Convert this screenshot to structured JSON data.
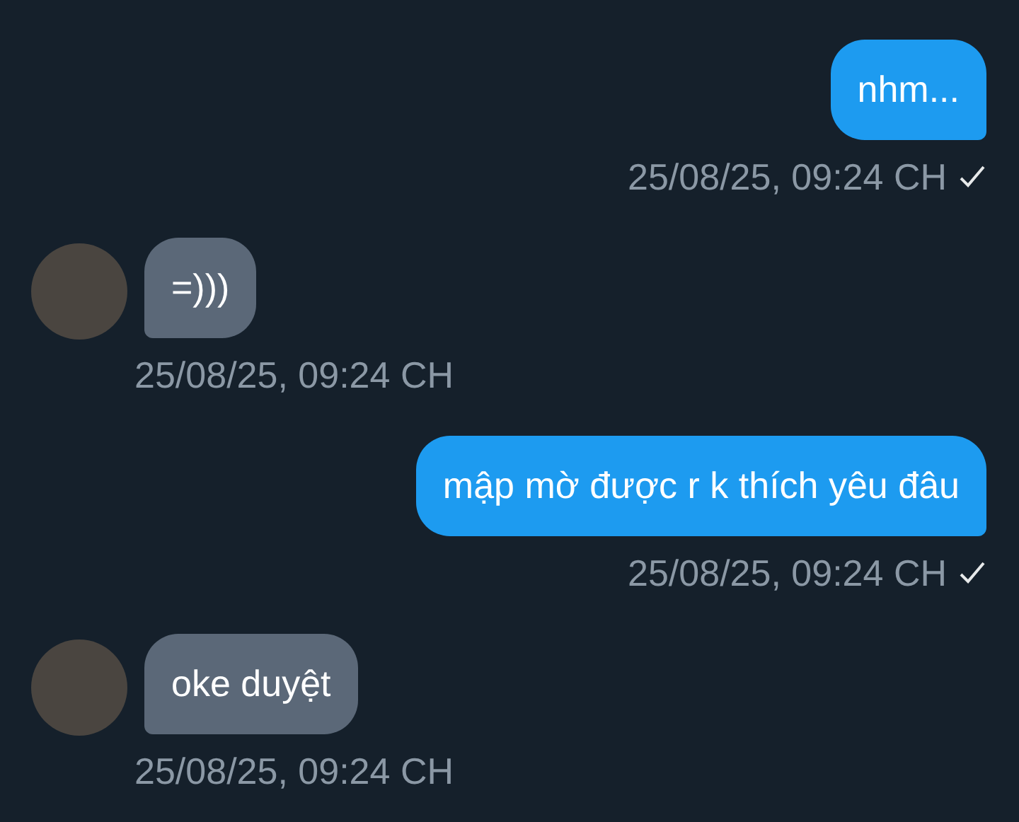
{
  "messages": [
    {
      "kind": "sent",
      "text": "nhm...",
      "time": "25/08/25, 09:24 CH",
      "checked": true
    },
    {
      "kind": "received",
      "text": "=)))",
      "time": "25/08/25, 09:24 CH"
    },
    {
      "kind": "sent",
      "text": "mập mờ được r k thích yêu đâu",
      "time": "25/08/25, 09:24 CH",
      "checked": true
    },
    {
      "kind": "received",
      "text": "oke duyệt",
      "time": "25/08/25, 09:24 CH"
    }
  ]
}
